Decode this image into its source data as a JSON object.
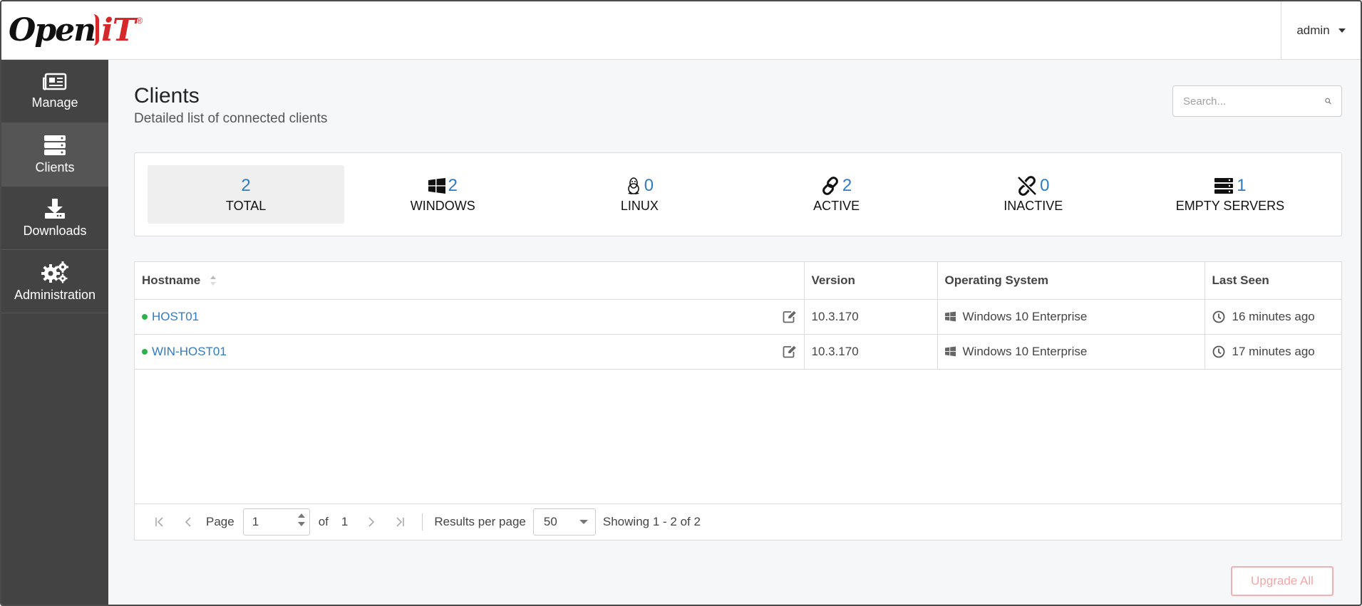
{
  "header": {
    "logo_text_1": "Open",
    "logo_text_2": "iT",
    "logo_reg": "®",
    "user": "admin"
  },
  "sidebar": {
    "items": [
      {
        "label": "Manage",
        "icon": "newspaper-icon"
      },
      {
        "label": "Clients",
        "icon": "server-stack-icon",
        "active": true
      },
      {
        "label": "Downloads",
        "icon": "download-icon"
      },
      {
        "label": "Administration",
        "icon": "gears-icon"
      }
    ]
  },
  "page": {
    "title": "Clients",
    "subtitle": "Detailed list of connected clients",
    "search_placeholder": "Search..."
  },
  "stats": [
    {
      "count": "2",
      "label": "TOTAL",
      "icon": "",
      "active": true
    },
    {
      "count": "2",
      "label": "WINDOWS",
      "icon": "windows-icon"
    },
    {
      "count": "0",
      "label": "LINUX",
      "icon": "linux-penguin-icon"
    },
    {
      "count": "2",
      "label": "ACTIVE",
      "icon": "link-icon"
    },
    {
      "count": "0",
      "label": "INACTIVE",
      "icon": "unlink-icon"
    },
    {
      "count": "1",
      "label": "EMPTY SERVERS",
      "icon": "server-icon"
    }
  ],
  "table": {
    "columns": [
      "Hostname",
      "Version",
      "Operating System",
      "Last Seen"
    ],
    "rows": [
      {
        "hostname": "HOST01",
        "version": "10.3.170",
        "os": "Windows 10 Enterprise",
        "last_seen": "16 minutes ago",
        "status_color": "#2db34a"
      },
      {
        "hostname": "WIN-HOST01",
        "version": "10.3.170",
        "os": "Windows 10 Enterprise",
        "last_seen": "17 minutes ago",
        "status_color": "#2db34a"
      }
    ]
  },
  "pager": {
    "page_label": "Page",
    "page_value": "1",
    "of_label": "of",
    "total_pages": "1",
    "results_label": "Results per page",
    "per_page": "50",
    "showing": "Showing 1 - 2 of 2"
  },
  "actions": {
    "upgrade_all": "Upgrade All"
  },
  "colors": {
    "accent": "#2f7bc6",
    "sidebar": "#434343",
    "status_online": "#2db34a",
    "brand_red": "#d6272b"
  }
}
